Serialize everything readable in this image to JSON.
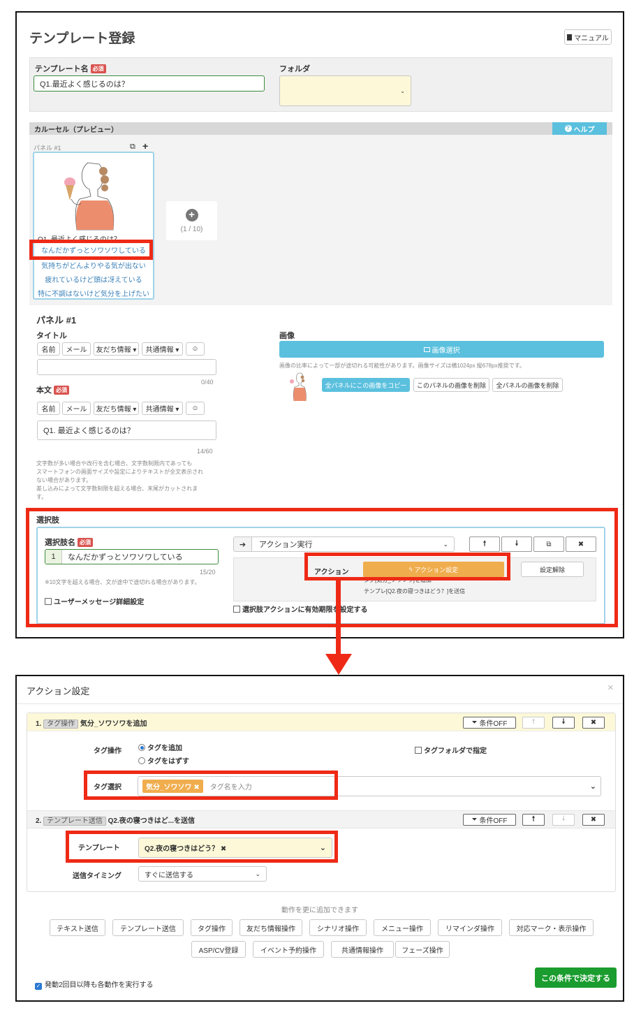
{
  "top": {
    "title": "テンプレート登録",
    "manual_button": "マニュアル",
    "template_name_label": "テンプレート名",
    "required_badge": "必須",
    "template_name_value": "Q1.最近よく感じるのは？",
    "folder_label": "フォルダ",
    "carousel_header": "カルーセル（プレビュー）",
    "help_button": "ヘルプ",
    "panel_caption": "パネル #1",
    "preview_title": "Q1. 最近よく感じるのは？",
    "preview_choices": [
      "なんだかずっとソワソワしている",
      "気持ちがどんよりやる気が出ない",
      "疲れているけど頭は冴えている",
      "特に不調はないけど気分を上げたい"
    ],
    "add_panel_counter": "(1 / 10)",
    "panel_heading": "パネル #1",
    "title_label": "タイトル",
    "insert_buttons": [
      "名前",
      "メール",
      "友だち情報 ▾",
      "共通情報 ▾"
    ],
    "title_counter": "0/40",
    "body_label": "本文",
    "body_value": "Q1. 最近よく感じるのは？",
    "body_counter": "14/60",
    "body_note": [
      "文字数が多い場合や改行を含む場合、文字数制限内であっても",
      "スマートフォンの画面サイズや設定によりテキストが全文表示され",
      "ない場合があります。",
      "差し込みによって文字数制限を超える場合、末尾がカットされま",
      "す。"
    ],
    "image_label": "画像",
    "image_select_button": "画像選択",
    "image_note": "画像の比率によって一部が途切れる可能性があります。画像サイズは横1024px 縦678px推奨です。",
    "copy_all_button": "全パネルにこの画像をコピー",
    "delete_this_button": "このパネルの画像を削除",
    "delete_all_button": "全パネルの画像を削除",
    "choices_heading": "選択肢",
    "choice_name_label": "選択肢名",
    "choice_index": "1",
    "choice_value": "なんだかずっとソワソワしている",
    "choice_counter": "15/20",
    "choice_note": "※10文字を超える場合、文が途中で途切れる場合があります。",
    "user_message_detail": "ユーザーメッセージ詳細設定",
    "action_select": "アクション実行",
    "action_label": "アクション",
    "action_setting_button": "アクション設定",
    "release_button": "設定解除",
    "action_summary_1": "タグ[気分_ソワソワ]を追加",
    "action_summary_2": "テンプレ[Q2.夜の寝つきはどう？]を送信",
    "expiry_checkbox": "選択肢アクションに有効期限を設定する"
  },
  "modal": {
    "title": "アクション設定",
    "row1_number": "1.",
    "row1_tag": "タグ操作",
    "row1_title": "気分_ソワソワを追加",
    "condition_off": "条件OFF",
    "tag_op_label": "タグ操作",
    "radio_add": "タグを追加",
    "radio_remove": "タグをはずす",
    "tag_folder_checkbox": "タグフォルダで指定",
    "tag_select_label": "タグ選択",
    "tag_chip": "気分_ソワソワ ✖",
    "tag_placeholder": "タグ名を入力",
    "row2_number": "2.",
    "row2_tag": "テンプレート送信",
    "row2_title": "Q2.夜の寝つきはど...を送信",
    "template_label": "テンプレート",
    "template_value": "Q2.夜の寝つきはどう？ ✖",
    "timing_label": "送信タイミング",
    "timing_value": "すぐに送信する",
    "add_more_text": "動作を更に追加できます",
    "add_buttons_row1": [
      "テキスト送信",
      "テンプレート送信",
      "タグ操作",
      "友だち情報操作",
      "シナリオ操作",
      "メニュー操作",
      "リマインダ操作",
      "対応マーク・表示操作"
    ],
    "add_buttons_row2": [
      "ASP/CV登録",
      "イベント予約操作",
      "共通情報操作",
      "フェーズ操作"
    ],
    "repeat_checkbox": "発動2回目以降も各動作を実行する",
    "submit_button": "この条件で決定する"
  },
  "colors": {
    "highlight_red": "#ee2a16",
    "accent_blue": "#5bc0de",
    "action_orange": "#f0ad4e",
    "submit_green": "#1a9c2e"
  }
}
